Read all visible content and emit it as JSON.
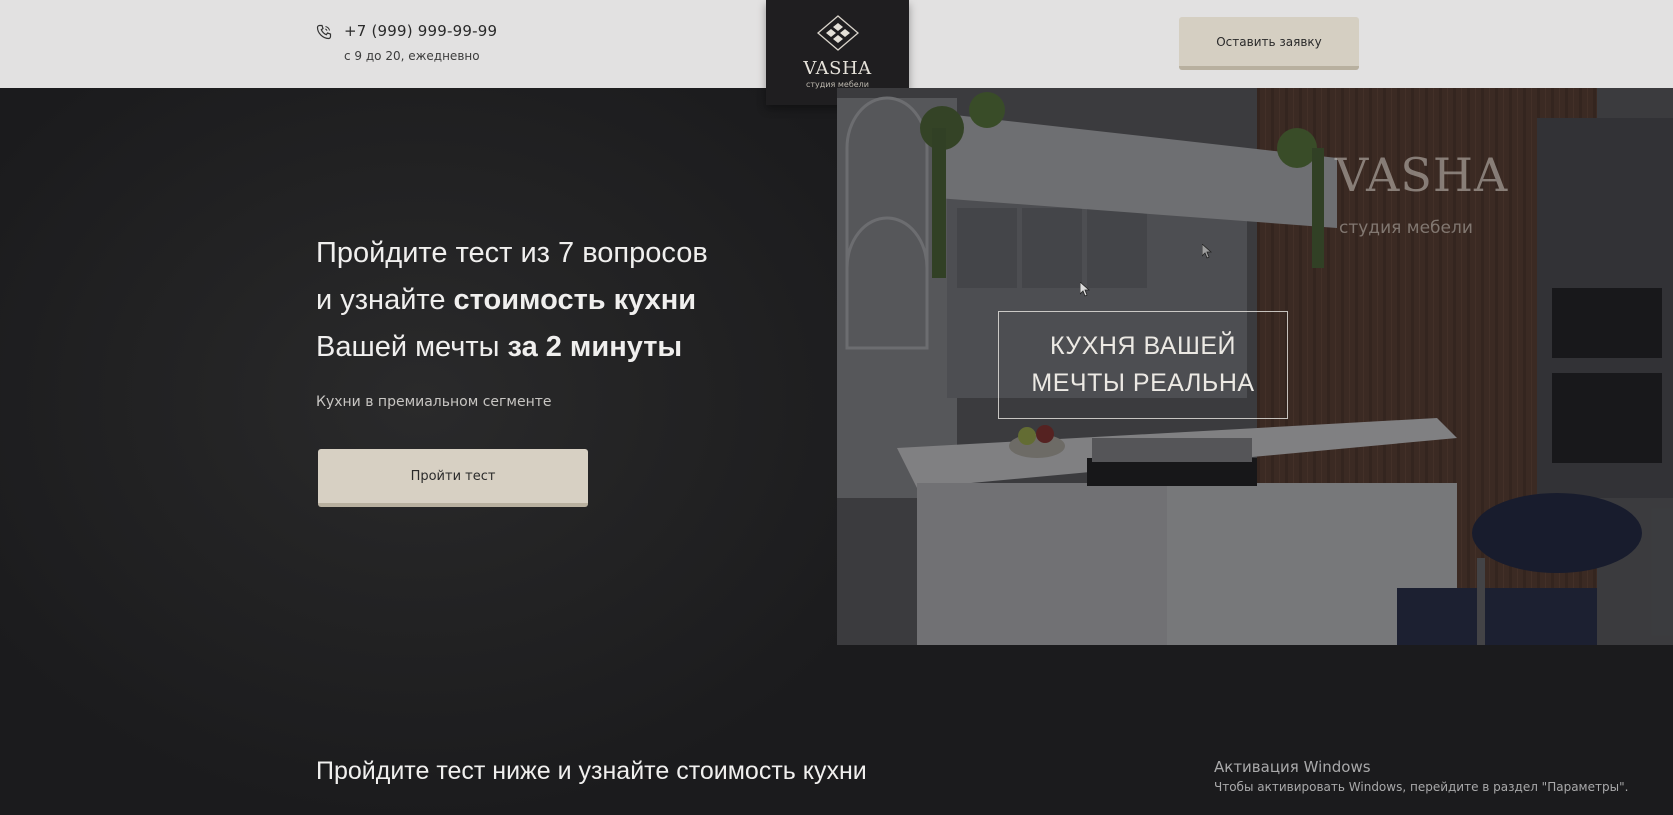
{
  "header": {
    "phone": "+7 (999) 999-99-99",
    "hours": "с 9 до 20, ежедневно",
    "logo_name": "VASHA",
    "logo_tagline": "студия мебели",
    "cta_label": "Оставить заявку"
  },
  "hero": {
    "title_line1": "Пройдите тест из 7 вопросов",
    "title_line2_plain": "и узнайте ",
    "title_line2_bold": "стоимость кухни",
    "title_line3_plain": "Вашей мечты ",
    "title_line3_bold": "за 2 минуты",
    "subtitle": "Кухни в премиальном сегменте",
    "button_label": "Пройти тест"
  },
  "kitchen_image": {
    "wall_brand": "VASHA",
    "wall_tagline": "студия мебели",
    "frame_line1": "КУХНЯ ВАШЕЙ",
    "frame_line2": "МЕЧТЫ РЕАЛЬНА"
  },
  "section": {
    "title": "Пройдите тест ниже и узнайте стоимость кухни"
  },
  "windows_watermark": {
    "title": "Активация Windows",
    "text": "Чтобы активировать Windows, перейдите в раздел \"Параметры\"."
  },
  "icons": {
    "phone": "phone-icon",
    "logo": "logo-emblem-icon"
  },
  "colors": {
    "header_bg": "#e2e1e1",
    "page_bg": "#1c1b1d",
    "button_bg": "#d7d0c3",
    "logo_box_bg": "#1f1e20"
  }
}
